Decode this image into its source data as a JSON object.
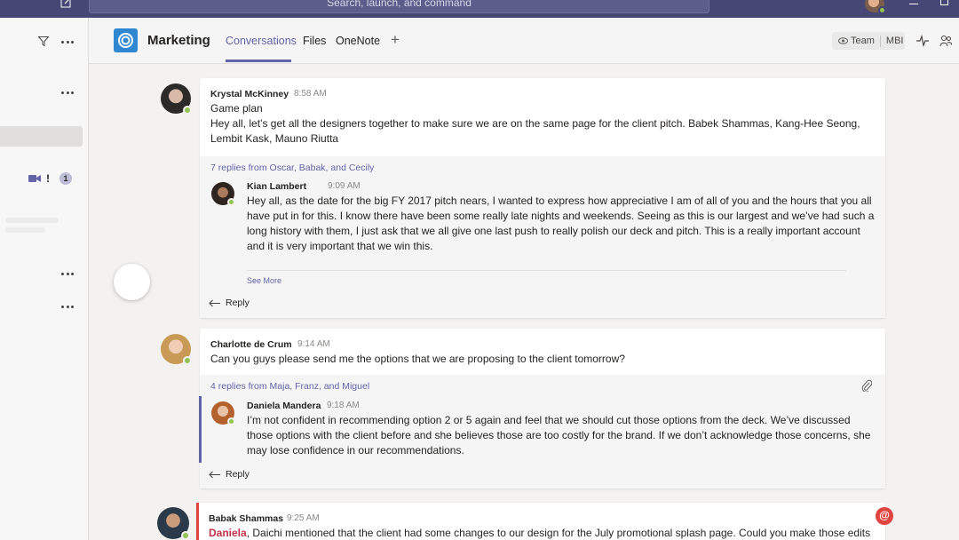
{
  "topbar": {
    "search_placeholder": "Search, launch, and command"
  },
  "leftpanel": {
    "badge_count": "1",
    "important_glyph": "!"
  },
  "header": {
    "team_name": "Marketing",
    "tabs": [
      {
        "label": "Conversations"
      },
      {
        "label": "Files"
      },
      {
        "label": "OneNote"
      }
    ],
    "add_tab": "+",
    "team_label": "Team",
    "org_label": "MBI"
  },
  "colors": {
    "accent": "#6264a7",
    "presence": "#92c353",
    "mention": "#c4314b",
    "team_logo": "#2f86d1"
  },
  "threads": [
    {
      "author": "Krystal McKinney",
      "time": "8:58 AM",
      "subject": "Game plan",
      "body": "Hey all, let’s get all the designers together to make sure we are on the same page for the client pitch. Babek Shammas, Kang-Hee Seong, Lembit Kask, Mauno Riutta",
      "replies_link": "7 replies from Oscar, Babak, and Cecily",
      "reply": {
        "author": "Kian Lambert",
        "time": "9:09 AM",
        "body": "Hey all, as the date for the big FY 2017 pitch nears, I wanted to express how appreciative I am of all of you and the hours that you all have put in for this. I know there have been some really late nights and weekends. Seeing as this is our largest and we’ve had such a long history with them, I just ask that we all give one last push to really polish our deck and pitch. This is a really important account and it is very important that we win this.",
        "see_more": "See More"
      },
      "reply_label": "Reply"
    },
    {
      "author": "Charlotte de Crum",
      "time": "9:14 AM",
      "body": "Can you guys please send me the options that we are proposing to the client tomorrow?",
      "replies_link": "4 replies from Maja, Franz, and Miguel",
      "reply": {
        "author": "Daniela Mandera",
        "time": "9:18 AM",
        "body": "I’m not confident in recommending option 2 or 5 again and feel that we should cut those options from the deck. We’ve discussed those options with the client before and she believes those are too costly for the brand. If we don’t acknowledge those concerns, she may lose confidence in our recommendations."
      },
      "reply_label": "Reply"
    },
    {
      "author": "Babak Shammas",
      "time": "9:25 AM",
      "mention": "Daniela",
      "body": ", Daichi mentioned that the client had some changes to our design for the July promotional splash page. Could you make those edits",
      "at_glyph": "@"
    }
  ]
}
